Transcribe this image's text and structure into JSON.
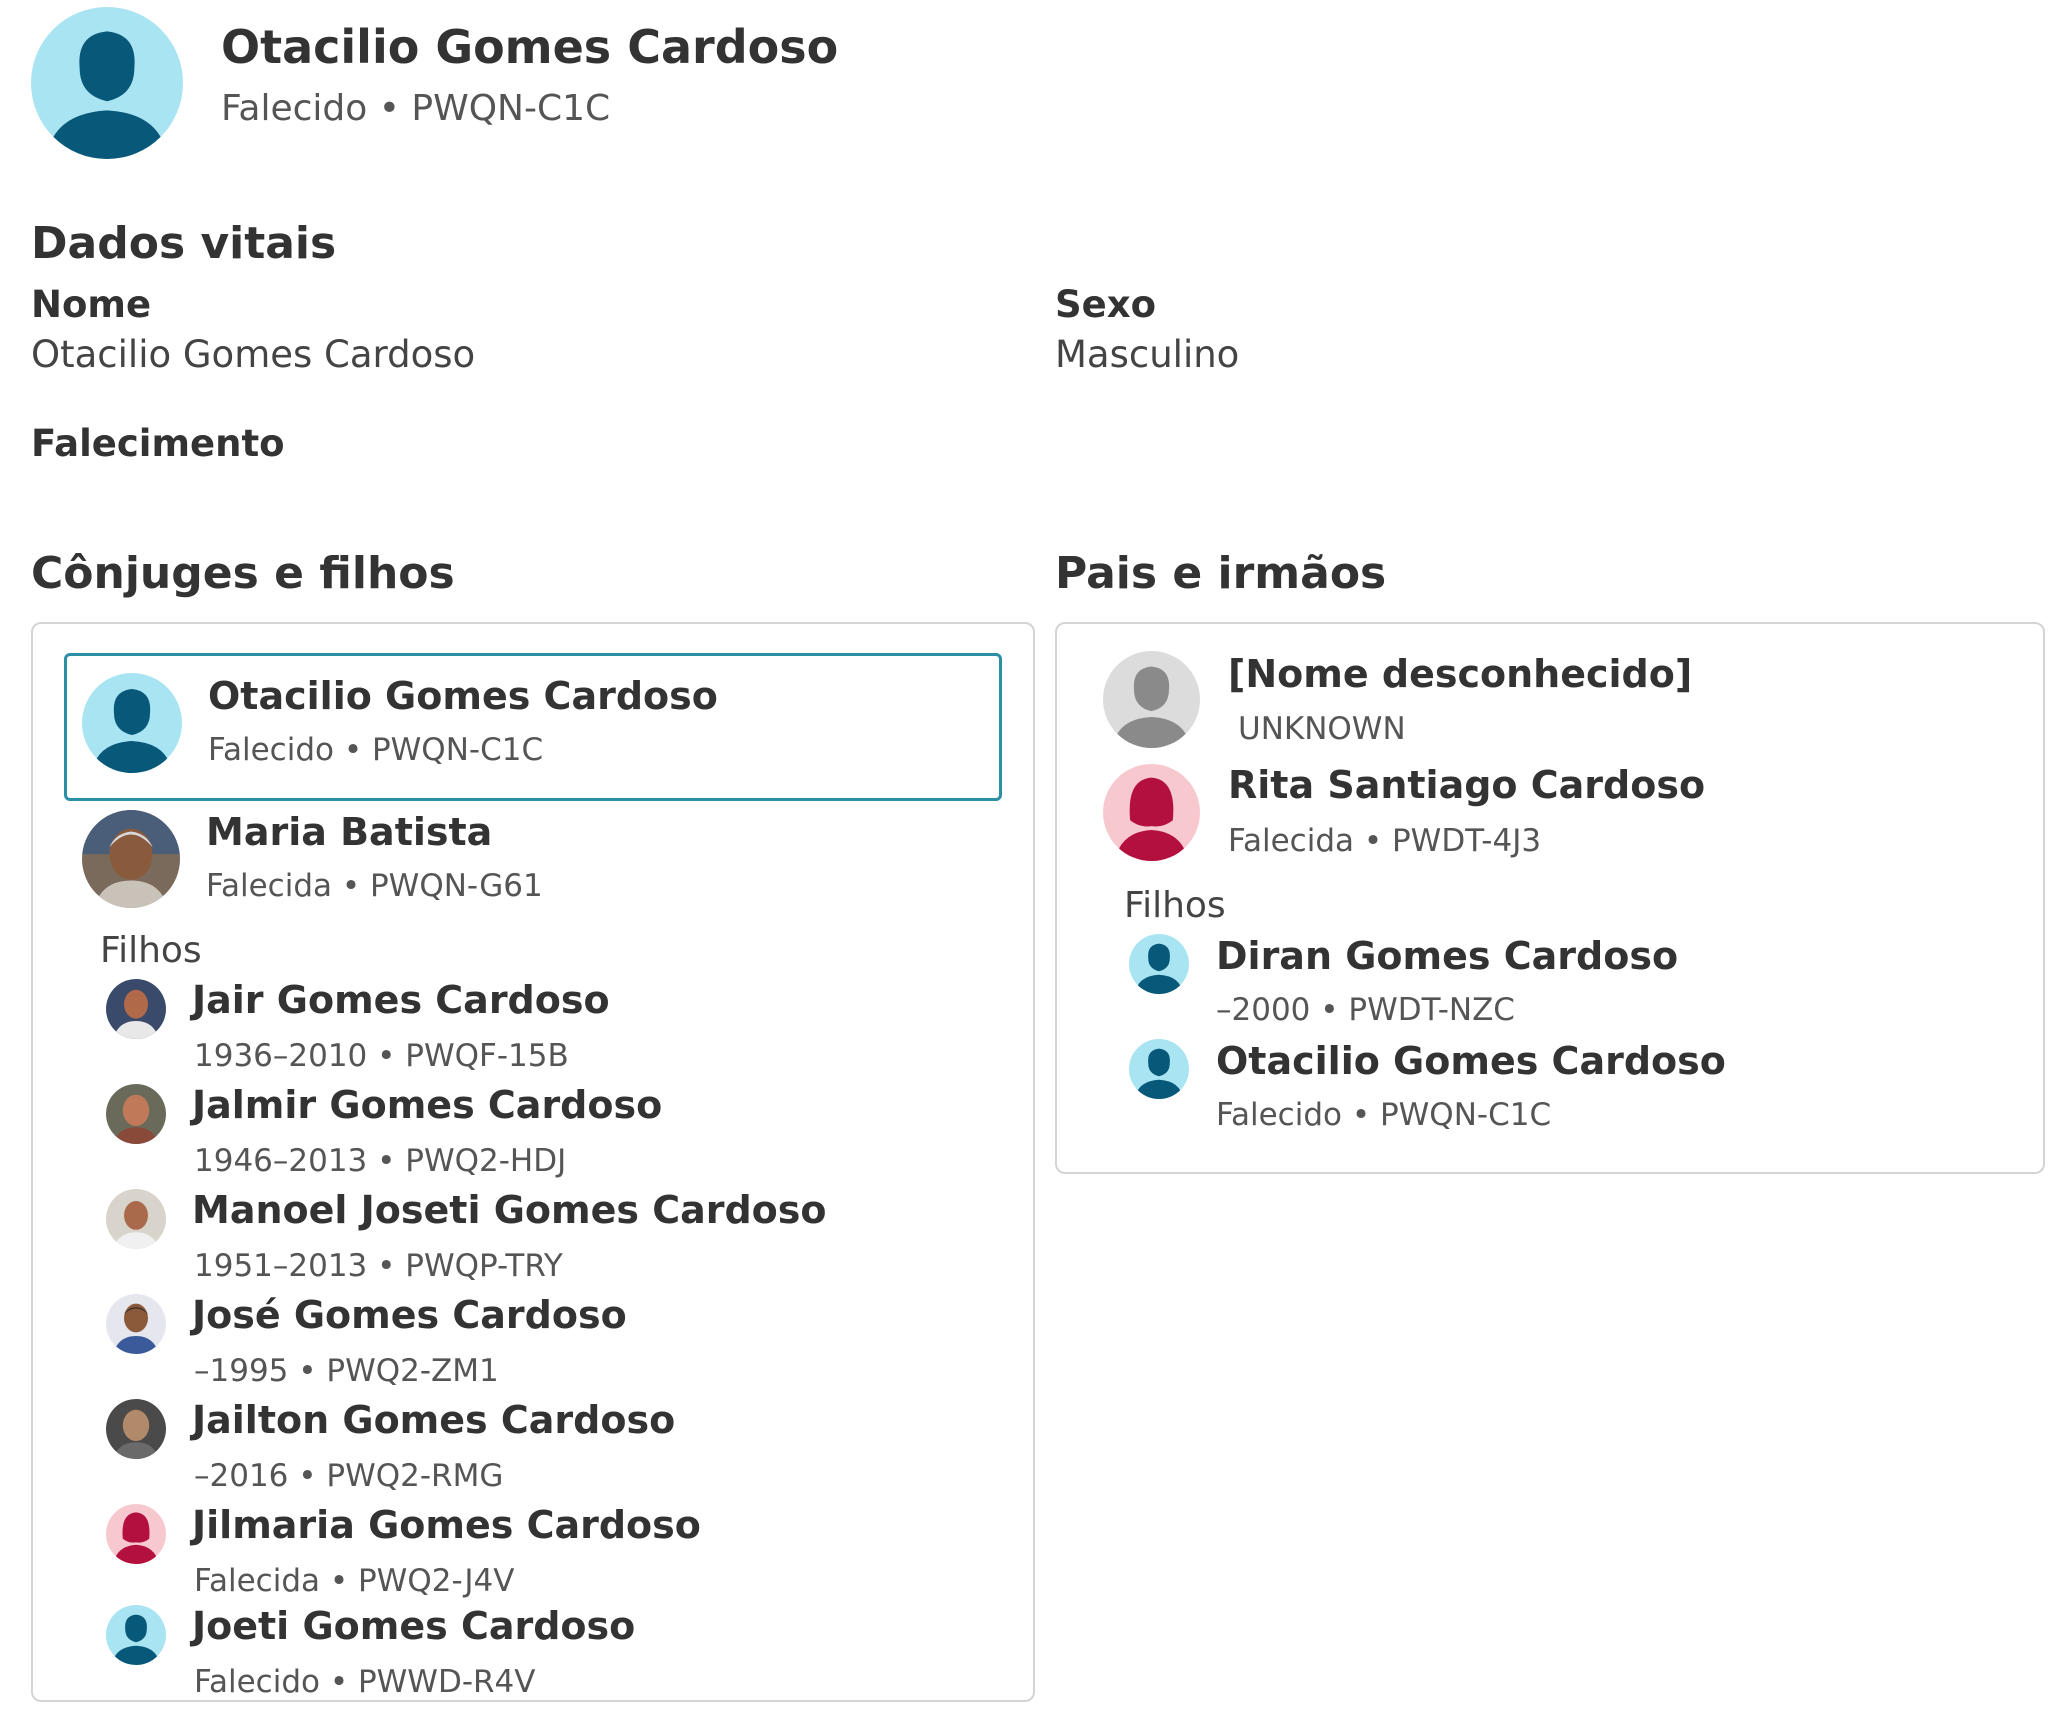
{
  "header": {
    "name": "Otacilio Gomes Cardoso",
    "subtitle": "Falecido • PWQN-C1C"
  },
  "vitals": {
    "title": "Dados vitais",
    "name_label": "Nome",
    "name_value": "Otacilio Gomes Cardoso",
    "sex_label": "Sexo",
    "sex_value": "Masculino",
    "death_label": "Falecimento"
  },
  "spouses": {
    "title": "Cônjuges e filhos",
    "couple": [
      {
        "name": "Otacilio Gomes Cardoso",
        "sub": "Falecido • PWQN-C1C",
        "avatar": "male-silhouette-icon"
      },
      {
        "name": "Maria Batista",
        "sub": "Falecida • PWQN-G61",
        "avatar": "photo-avatar"
      }
    ],
    "children_label": "Filhos",
    "children": [
      {
        "name": "Jair Gomes Cardoso",
        "sub": "1936–2010 • PWQF-15B",
        "avatar": "photo-avatar"
      },
      {
        "name": "Jalmir Gomes Cardoso",
        "sub": "1946–2013 • PWQ2-HDJ",
        "avatar": "photo-avatar"
      },
      {
        "name": "Manoel Joseti Gomes Cardoso",
        "sub": "1951–2013 • PWQP-TRY",
        "avatar": "photo-avatar"
      },
      {
        "name": "José Gomes Cardoso",
        "sub": "–1995 • PWQ2-ZM1",
        "avatar": "photo-avatar"
      },
      {
        "name": "Jailton Gomes Cardoso",
        "sub": "–2016 • PWQ2-RMG",
        "avatar": "photo-avatar"
      },
      {
        "name": "Jilmaria Gomes Cardoso",
        "sub": "Falecida • PWQ2-J4V",
        "avatar": "female-silhouette-icon"
      },
      {
        "name": "Joeti Gomes Cardoso",
        "sub": "Falecido • PWWD-R4V",
        "avatar": "male-silhouette-icon"
      }
    ]
  },
  "parents": {
    "title": "Pais e irmãos",
    "couple": [
      {
        "name": "[Nome desconhecido]",
        "sub": "UNKNOWN",
        "avatar": "unknown-silhouette-icon"
      },
      {
        "name": "Rita Santiago Cardoso",
        "sub": "Falecida • PWDT-4J3",
        "avatar": "female-silhouette-icon"
      }
    ],
    "children_label": "Filhos",
    "children": [
      {
        "name": "Diran Gomes Cardoso",
        "sub": "–2000 • PWDT-NZC",
        "avatar": "male-silhouette-icon"
      },
      {
        "name": "Otacilio Gomes Cardoso",
        "sub": "Falecido • PWQN-C1C",
        "avatar": "male-silhouette-icon"
      }
    ]
  },
  "colors": {
    "male_bg": "#a9e4f3",
    "male_fg": "#08587a",
    "female_bg": "#f7c9cf",
    "female_fg": "#b3103e",
    "unknown_bg": "#dcdcdc",
    "unknown_fg": "#8a8a8a",
    "selected_border": "#2b8fa6"
  }
}
